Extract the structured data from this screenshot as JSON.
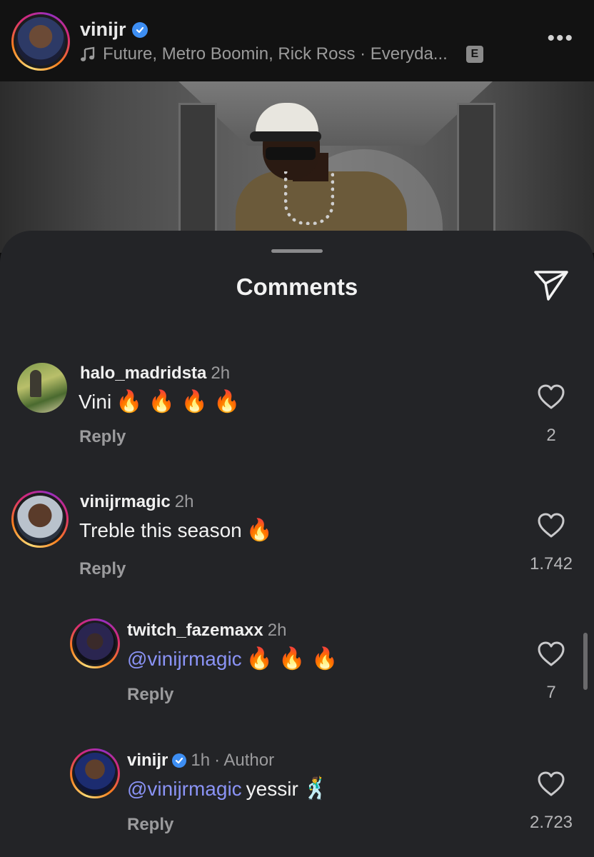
{
  "header": {
    "username": "vinijr",
    "verified": true,
    "music_text": "Future, Metro Boomin, Rick Ross · Everyda...",
    "explicit_badge": "E",
    "more_label": "•••"
  },
  "sheet": {
    "title": "Comments"
  },
  "comments": [
    {
      "username": "halo_madridsta",
      "time": "2h",
      "text": "Vini",
      "emojis": "🔥 🔥 🔥 🔥",
      "reply_label": "Reply",
      "likes": "2"
    },
    {
      "username": "vinijrmagic",
      "time": "2h",
      "text": "Treble this season",
      "emojis": "🔥",
      "reply_label": "Reply",
      "likes": "1.742"
    },
    {
      "username": "twitch_fazemaxx",
      "time": "2h",
      "mention": "@vinijrmagic",
      "emojis": "🔥 🔥 🔥",
      "reply_label": "Reply",
      "likes": "7"
    },
    {
      "username": "vinijr",
      "verified": true,
      "time": "1h",
      "author_label": "· Author",
      "mention": "@vinijrmagic",
      "text": "yessir",
      "emojis": "🕺",
      "reply_label": "Reply",
      "likes": "2.723"
    }
  ],
  "colors": {
    "sheet_bg": "#232427",
    "mention": "#8a93f5",
    "verified": "#3d8ef3",
    "secondary_text": "#9b9b9d"
  },
  "icons": [
    "music-note-icon",
    "verified-badge-icon",
    "more-icon",
    "share-paper-plane-icon",
    "heart-icon"
  ]
}
